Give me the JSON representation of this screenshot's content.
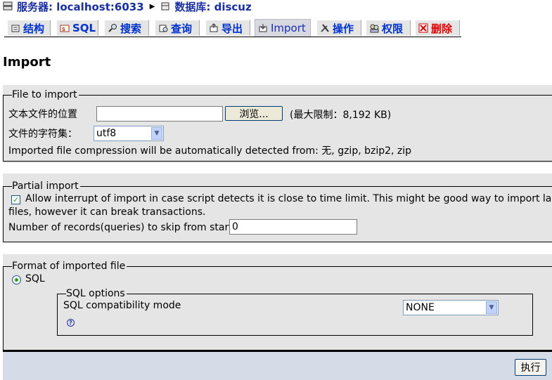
{
  "breadcrumb": {
    "server": "服务器: localhost:6033",
    "database": "数据库: discuz"
  },
  "tabs": [
    {
      "label": "结构",
      "icon": "structure-icon"
    },
    {
      "label": "SQL",
      "icon": "sql-icon"
    },
    {
      "label": "搜索",
      "icon": "search-icon"
    },
    {
      "label": "查询",
      "icon": "query-icon"
    },
    {
      "label": "导出",
      "icon": "export-icon"
    },
    {
      "label": "Import",
      "icon": "import-icon",
      "active": true
    },
    {
      "label": "操作",
      "icon": "operations-icon"
    },
    {
      "label": "权限",
      "icon": "privileges-icon"
    },
    {
      "label": "删除",
      "icon": "drop-icon"
    }
  ],
  "page_title": "Import",
  "file_section": {
    "legend": "File to import",
    "location_label": "文本文件的位置",
    "file_value": "",
    "browse_label": "浏览...",
    "max_size": "(最大限制：8,192 KB)",
    "charset_label": "文件的字符集：",
    "charset_value": "utf8",
    "compression_note": "Imported file compression will be automatically detected from: 无, gzip, bzip2, zip"
  },
  "partial_section": {
    "legend": "Partial import",
    "allow_interrupt_line1": "Allow interrupt of import in case script detects it is close to time limit. This might be good way to import large",
    "allow_interrupt_line2": "files, however it can break transactions.",
    "allow_interrupt_checked": true,
    "skip_label": "Number of records(queries) to skip from start",
    "skip_value": "0"
  },
  "format_section": {
    "legend": "Format of imported file",
    "format_sql": "SQL",
    "sql_options_legend": "SQL options",
    "compat_label": "SQL compatibility mode",
    "compat_value": "NONE"
  },
  "submit_label": "执行",
  "colors": {
    "link": "#1a2f9e",
    "tab_danger": "#e00000",
    "panel": "#e5e5e5",
    "footer": "#d5dce8"
  }
}
